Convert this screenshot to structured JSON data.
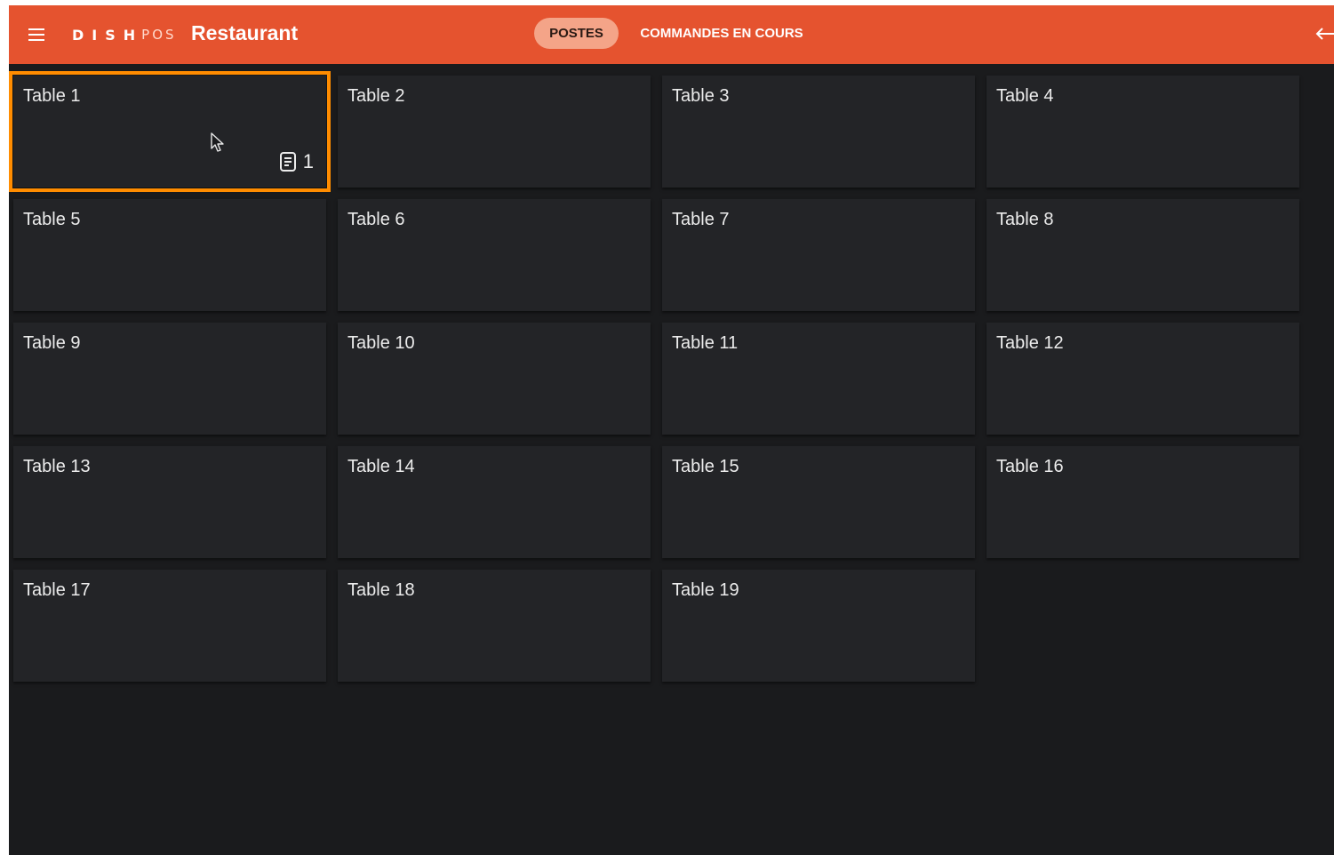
{
  "header": {
    "logo_dish": "DISH",
    "logo_pos": "POS",
    "title": "Restaurant",
    "tabs": [
      {
        "label": "POSTES",
        "active": true
      },
      {
        "label": "COMMANDES EN COURS",
        "active": false
      }
    ],
    "menu_icon": "hamburger-menu-icon",
    "logout_icon": "logout-arrow-icon"
  },
  "colors": {
    "header_bg": "#e5532f",
    "active_tab_bg": "#f4a488",
    "page_bg": "#1a1b1d",
    "card_bg": "#232427",
    "selection_outline": "#ff8c00"
  },
  "tables": [
    {
      "name": "Table 1",
      "orders": "1",
      "selected": true
    },
    {
      "name": "Table 2"
    },
    {
      "name": "Table 3"
    },
    {
      "name": "Table 4"
    },
    {
      "name": "Table 5"
    },
    {
      "name": "Table 6"
    },
    {
      "name": "Table 7"
    },
    {
      "name": "Table 8"
    },
    {
      "name": "Table 9"
    },
    {
      "name": "Table 10"
    },
    {
      "name": "Table 11"
    },
    {
      "name": "Table 12"
    },
    {
      "name": "Table 13"
    },
    {
      "name": "Table 14"
    },
    {
      "name": "Table 15"
    },
    {
      "name": "Table 16"
    },
    {
      "name": "Table 17"
    },
    {
      "name": "Table 18"
    },
    {
      "name": "Table 19"
    }
  ]
}
